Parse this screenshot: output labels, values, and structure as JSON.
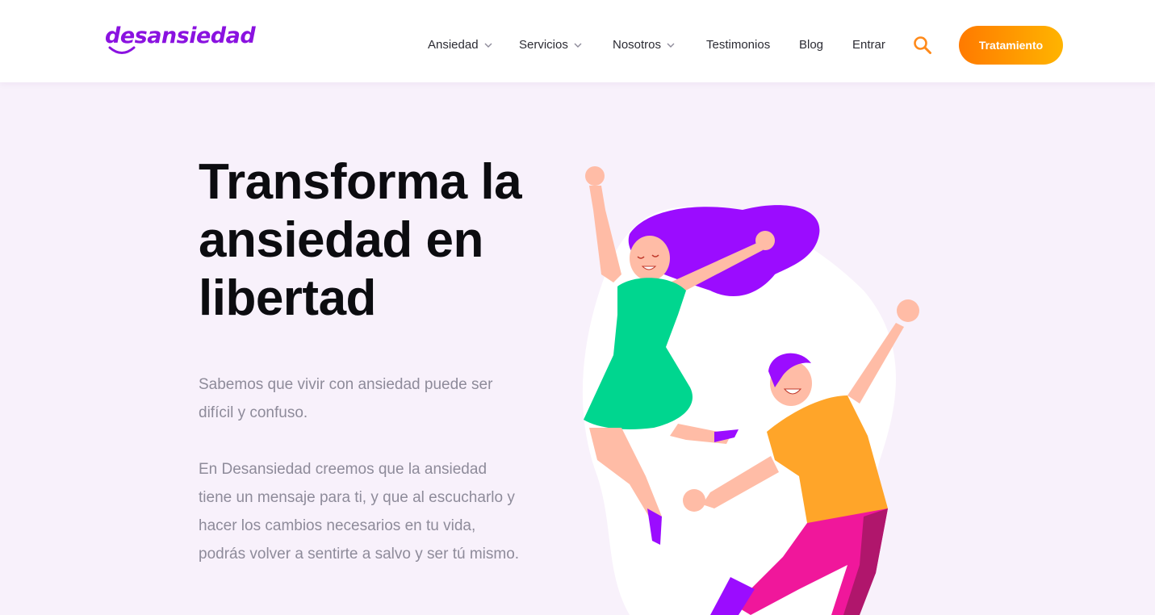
{
  "brand": {
    "logo_text": "desansiedad",
    "accent": "#8a12e0"
  },
  "nav": {
    "items": [
      {
        "label": "Ansiedad",
        "has_dropdown": true
      },
      {
        "label": "Servicios",
        "has_dropdown": true
      },
      {
        "label": "Nosotros",
        "has_dropdown": true
      },
      {
        "label": "Testimonios",
        "has_dropdown": false
      },
      {
        "label": "Blog",
        "has_dropdown": false
      },
      {
        "label": "Entrar",
        "has_dropdown": false
      }
    ],
    "search_icon": "search-icon",
    "cta_label": "Tratamiento",
    "cta_colors": [
      "#ff7a00",
      "#ffb400"
    ]
  },
  "hero": {
    "title": "Transforma la ansiedad en libertad",
    "paragraph_1": "Sabemos que vivir con ansiedad puede ser difícil y confuso.",
    "paragraph_2": "En Desansiedad creemos que la ansiedad tiene un mensaje para ti, y que al escucharlo y hacer los cambios necesarios en tu vida, podrás volver a sentirte a salvo y ser tú mismo.",
    "background": "#f8f1fb"
  }
}
